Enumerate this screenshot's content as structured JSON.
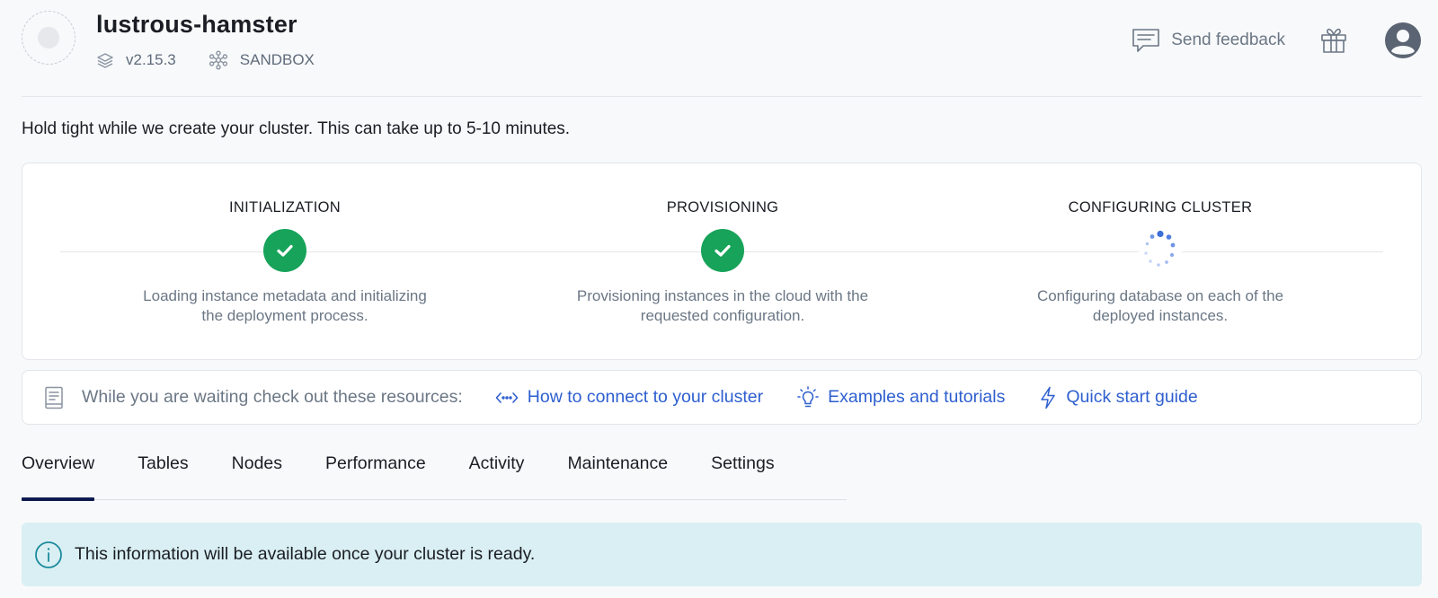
{
  "header": {
    "cluster_name": "lustrous-hamster",
    "version": "v2.15.3",
    "plan": "SANDBOX",
    "feedback_label": "Send feedback",
    "icons": [
      "layers-icon",
      "sandbox-icon",
      "feedback-icon",
      "gift-icon",
      "user-icon"
    ]
  },
  "status_message": "Hold tight while we create your cluster. This can take up to 5-10 minutes.",
  "steps": [
    {
      "title": "INITIALIZATION",
      "description": "Loading instance metadata and initializing the deployment process.",
      "state": "done"
    },
    {
      "title": "PROVISIONING",
      "description": "Provisioning instances in the cloud with the requested configuration.",
      "state": "done"
    },
    {
      "title": "CONFIGURING CLUSTER",
      "description": "Configuring database on each of the deployed instances.",
      "state": "in-progress"
    }
  ],
  "resources": {
    "lead": "While you are waiting check out these resources:",
    "links": [
      {
        "label": "How to connect to your cluster",
        "icon": "code-arrows-icon"
      },
      {
        "label": "Examples and tutorials",
        "icon": "lightbulb-icon"
      },
      {
        "label": "Quick start guide",
        "icon": "lightning-icon"
      }
    ]
  },
  "tabs": [
    {
      "label": "Overview",
      "active": true
    },
    {
      "label": "Tables",
      "active": false
    },
    {
      "label": "Nodes",
      "active": false
    },
    {
      "label": "Performance",
      "active": false
    },
    {
      "label": "Activity",
      "active": false
    },
    {
      "label": "Maintenance",
      "active": false
    },
    {
      "label": "Settings",
      "active": false
    }
  ],
  "notice": {
    "text": "This information will be available once your cluster is ready.",
    "icon": "info-icon"
  },
  "colors": {
    "success": "#17a35a",
    "link": "#2e5fcf",
    "active_tab": "#0e1a4f",
    "notice_bg": "#d9eff3",
    "spinner": "#3b6fd8"
  }
}
